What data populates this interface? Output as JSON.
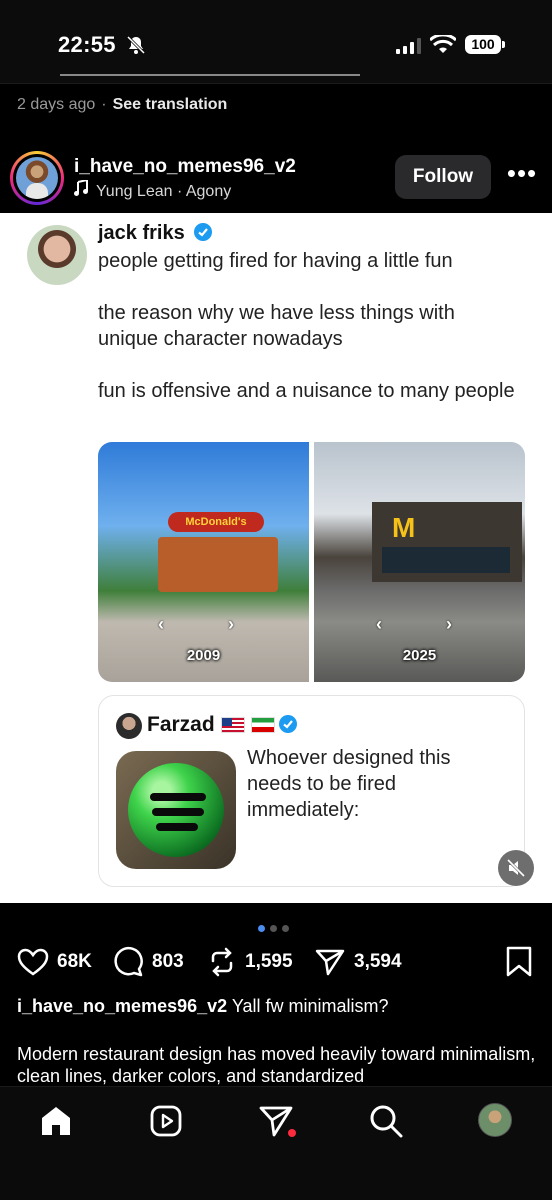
{
  "status_bar": {
    "time": "22:55",
    "battery": "100"
  },
  "meta": {
    "time_ago": "2 days ago",
    "separator": "·",
    "see_translation": "See translation"
  },
  "post_header": {
    "username": "i_have_no_memes96_v2",
    "music": "Yung Lean · Agony",
    "follow_label": "Follow",
    "more_label": "•••"
  },
  "tweet": {
    "author": "jack friks",
    "paragraphs": [
      "people getting fired for having a little fun",
      "the reason why we have less things with unique character nowadays",
      "fun is offensive and a nuisance to many people"
    ],
    "image_left_year": "2009",
    "image_right_year": "2025",
    "image_left_sign": "McDonald's",
    "image_right_logo": "M",
    "quote": {
      "author": "Farzad",
      "text": "Whoever designed this needs to be fired immediately:"
    }
  },
  "actions": {
    "likes": "68K",
    "comments": "803",
    "reposts": "1,595",
    "shares": "3,594"
  },
  "caption": {
    "username": "i_have_no_memes96_v2",
    "text": "Yall fw minimalism?",
    "body": "Modern restaurant design has moved heavily toward minimalism, clean lines, darker colors, and standardized"
  },
  "carousel": {
    "count": 3,
    "active": 1
  },
  "colors": {
    "accent_blue": "#4b8df0",
    "verified_blue": "#1d9bf0",
    "notification_red": "#ff2a3d"
  },
  "icons": {
    "bell": "bell-slash-icon",
    "like": "heart-icon",
    "comment": "comment-icon",
    "repost": "repost-icon",
    "share": "send-icon",
    "save": "bookmark-icon",
    "home": "home-icon",
    "reels": "reels-icon",
    "messages": "send-icon",
    "search": "search-icon"
  }
}
